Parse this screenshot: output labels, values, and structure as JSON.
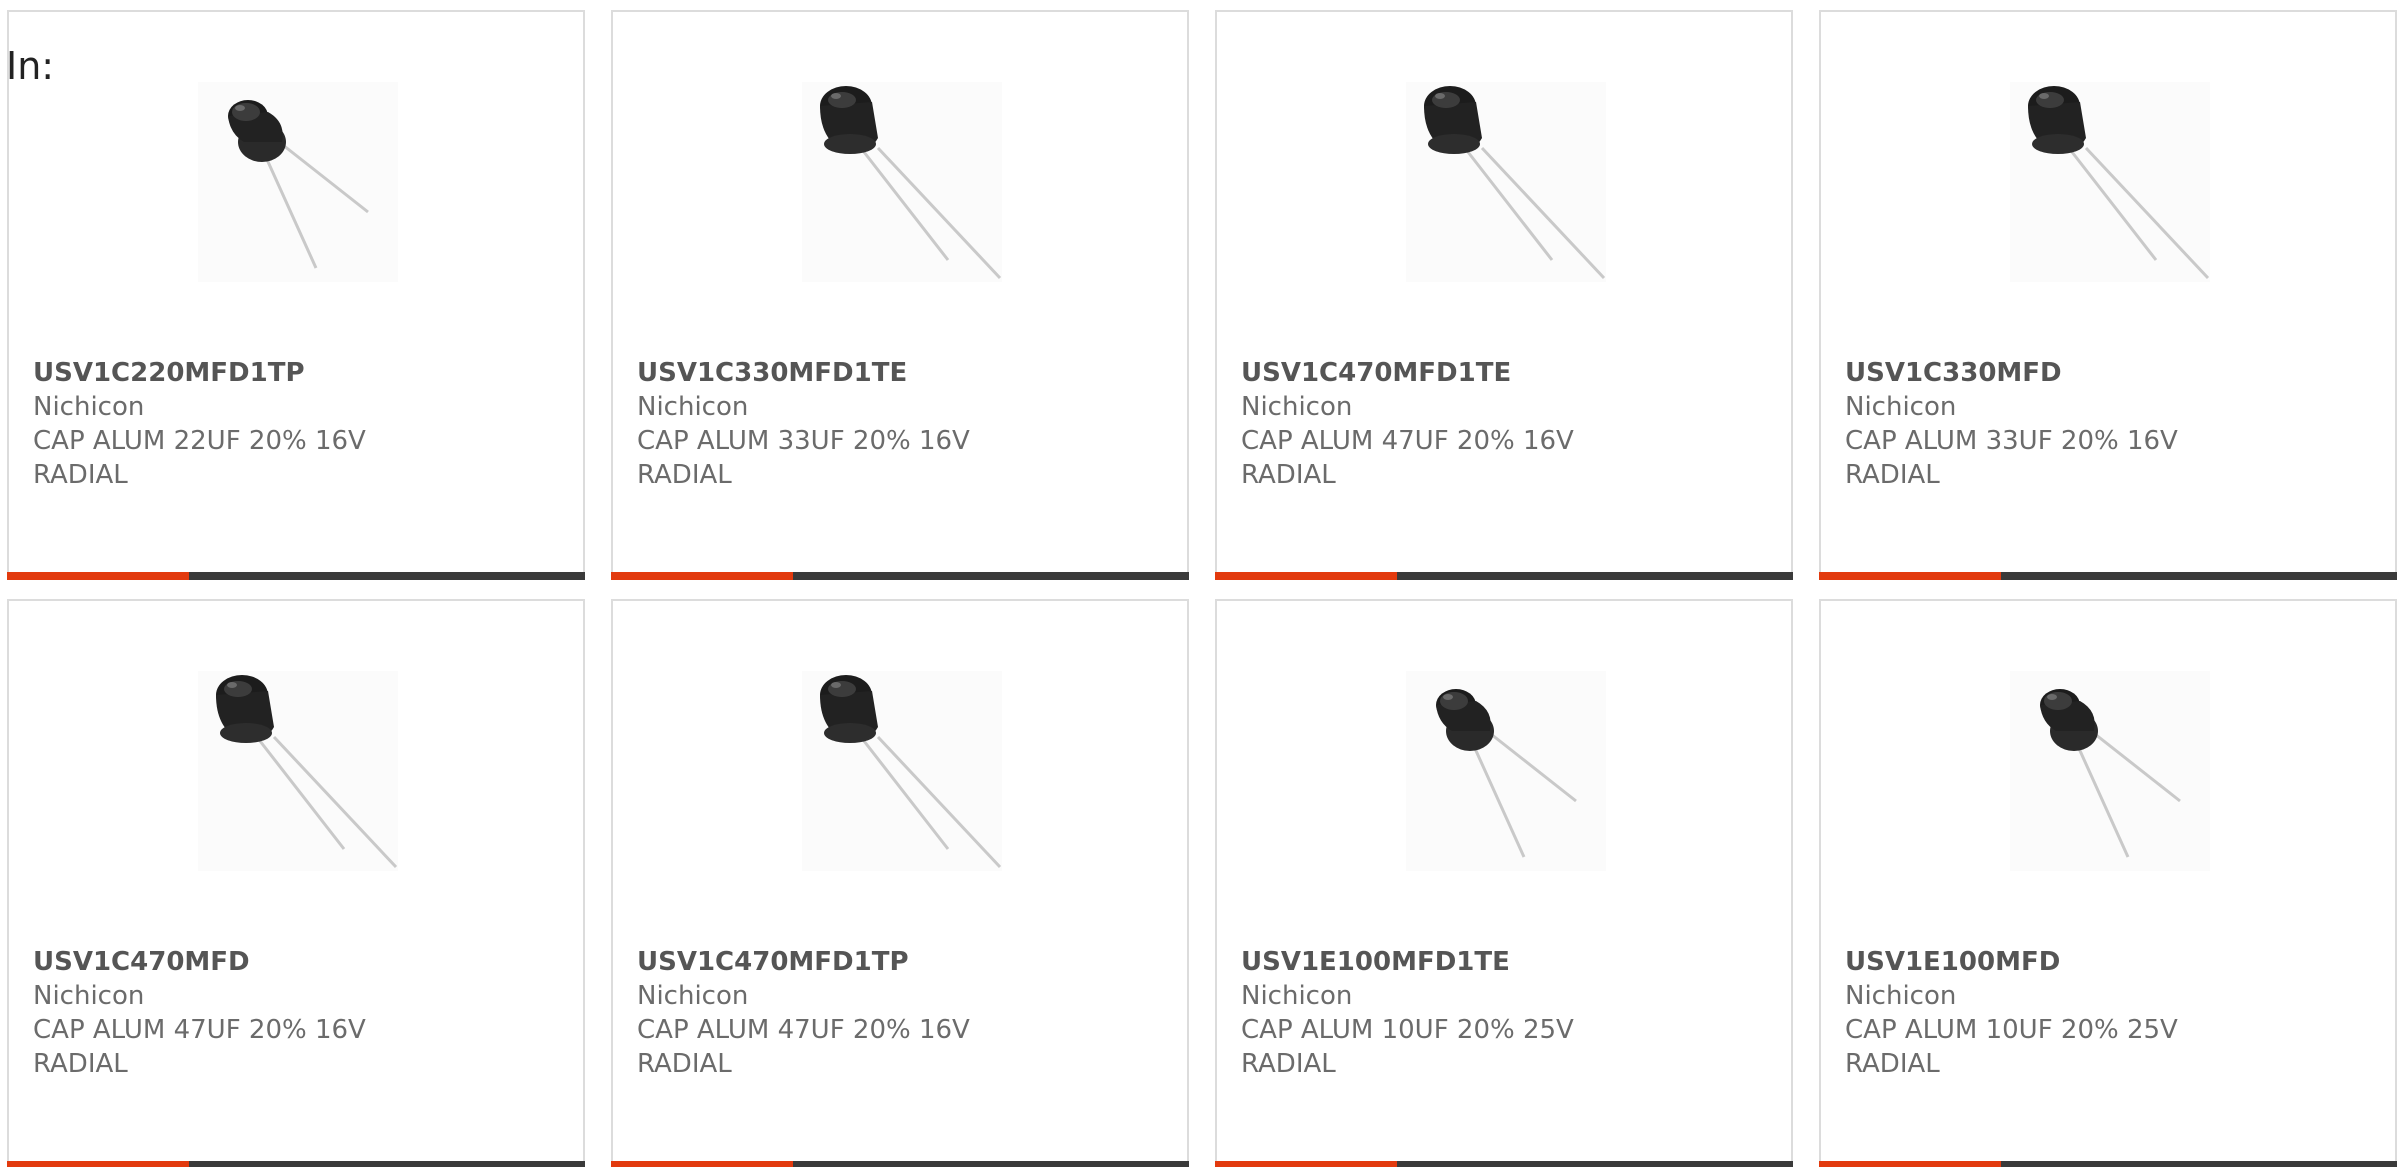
{
  "filter": {
    "label": "In:"
  },
  "accent_color": "#e23a0e",
  "bar_color": "#3a3a3a",
  "products": [
    {
      "part_number": "USV1C220MFD1TP",
      "manufacturer": "Nichicon",
      "description_line1": "CAP ALUM 22UF 20% 16V",
      "description_line2": "RADIAL",
      "image": "radial-capacitor"
    },
    {
      "part_number": "USV1C330MFD1TE",
      "manufacturer": "Nichicon",
      "description_line1": "CAP ALUM 33UF 20% 16V",
      "description_line2": "RADIAL",
      "image": "radial-capacitor"
    },
    {
      "part_number": "USV1C470MFD1TE",
      "manufacturer": "Nichicon",
      "description_line1": "CAP ALUM 47UF 20% 16V",
      "description_line2": "RADIAL",
      "image": "radial-capacitor"
    },
    {
      "part_number": "USV1C330MFD",
      "manufacturer": "Nichicon",
      "description_line1": "CAP ALUM 33UF 20% 16V",
      "description_line2": "RADIAL",
      "image": "radial-capacitor"
    },
    {
      "part_number": "USV1C470MFD",
      "manufacturer": "Nichicon",
      "description_line1": "CAP ALUM 47UF 20% 16V",
      "description_line2": "RADIAL",
      "image": "radial-capacitor"
    },
    {
      "part_number": "USV1C470MFD1TP",
      "manufacturer": "Nichicon",
      "description_line1": "CAP ALUM 47UF 20% 16V",
      "description_line2": "RADIAL",
      "image": "radial-capacitor"
    },
    {
      "part_number": "USV1E100MFD1TE",
      "manufacturer": "Nichicon",
      "description_line1": "CAP ALUM 10UF 20% 25V",
      "description_line2": "RADIAL",
      "image": "radial-capacitor"
    },
    {
      "part_number": "USV1E100MFD",
      "manufacturer": "Nichicon",
      "description_line1": "CAP ALUM 10UF 20% 25V",
      "description_line2": "RADIAL",
      "image": "radial-capacitor"
    }
  ]
}
